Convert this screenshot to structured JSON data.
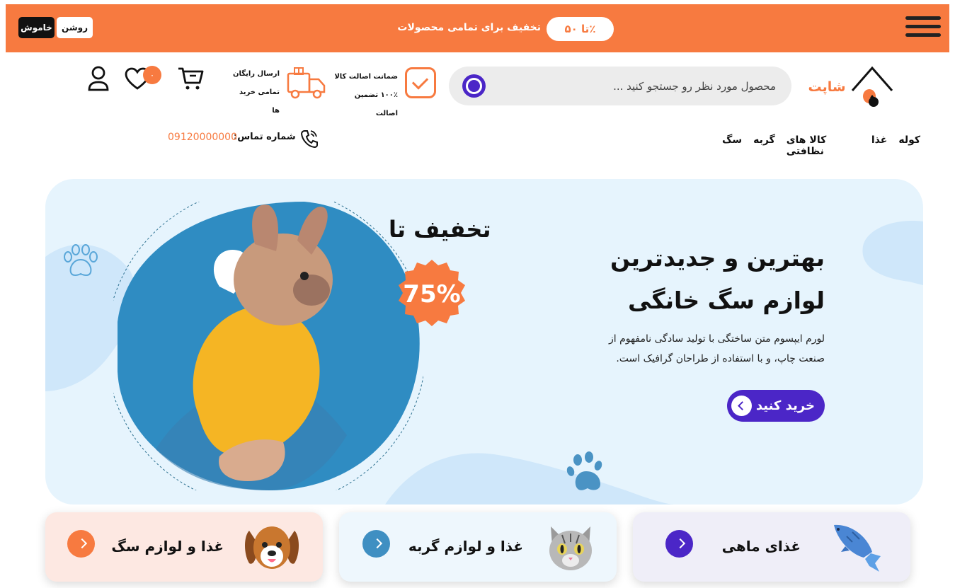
{
  "topbar": {
    "promo_pill": "تا ۵۰٪",
    "promo_text": "تخفیف برای تمامی محصولات",
    "theme_light": "روشن",
    "theme_dark": "خاموش"
  },
  "header": {
    "logo_text": "شاپت",
    "search_placeholder": "محصول مورد نظر رو جستجو کنید ...",
    "feature1_line1": "ضمانت اصالت کالا",
    "feature1_line2": "۱۰۰٪ تضمین اصالت",
    "feature2_line1": "ارسال رایگان",
    "feature2_line2": "تمامی خرید ها",
    "wishlist_count": "۰"
  },
  "nav": {
    "items": [
      "کوله",
      "غذا",
      "کالا های نظافتی",
      "گربه",
      "سگ"
    ],
    "phone_label": "شماره تماس:",
    "phone_number": "09120000000"
  },
  "hero": {
    "title_line1": "بهترین و جدیدترین",
    "title_line2": "لوازم سگ خانگی",
    "description": "لورم ایپسوم متن ساختگی با تولید سادگی نامفهوم از صنعت چاپ، و با استفاده از طراحان گرافیک است.",
    "buy_label": "خرید کنید",
    "discount_title": "تخفیف تا",
    "discount_value": "75%"
  },
  "categories": [
    {
      "title": "غذا و لوازم سگ",
      "color": "#f77a40"
    },
    {
      "title": "غذا و لوازم گربه",
      "color": "#3f8fc2"
    },
    {
      "title": "غذای ماهی",
      "color": "#4b26c7"
    }
  ],
  "colors": {
    "accent": "#f77a40",
    "primary": "#4b26c7",
    "hero_bg": "#e6f4fd"
  }
}
